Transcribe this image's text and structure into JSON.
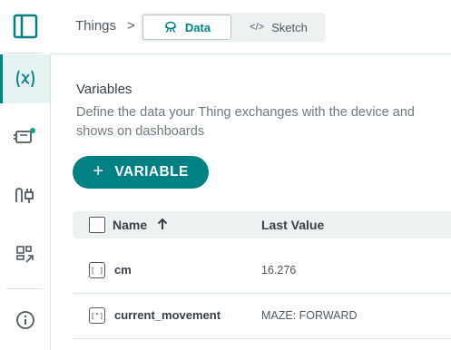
{
  "colors": {
    "accent": "#008184",
    "header_bg": "#ecf1f1",
    "text": "#374146"
  },
  "sidebar": {
    "items": [
      {
        "icon": "panel-toggle-icon",
        "active": false
      },
      {
        "icon": "variable-icon",
        "active": true
      },
      {
        "icon": "device-icon",
        "active": false,
        "badge": true
      },
      {
        "icon": "network-icon",
        "active": false
      },
      {
        "icon": "dashboard-link-icon",
        "active": false
      },
      {
        "icon": "info-icon",
        "active": false
      }
    ]
  },
  "breadcrumb": {
    "root": "Things",
    "separator": ">"
  },
  "tabs": {
    "data": "Data",
    "sketch": "Sketch",
    "sketch_glyph": "</>"
  },
  "variables": {
    "title": "Variables",
    "description": "Define the data your Thing exchanges with the device and shows on dashboards",
    "add_label": "VARIABLE",
    "add_glyph": "+"
  },
  "table": {
    "col_name": "Name",
    "col_last_value": "Last Value",
    "rows": [
      {
        "name": "cm",
        "value": "16.276",
        "type_glyph": "[ ]"
      },
      {
        "name": "current_movement",
        "value": "MAZE: FORWARD",
        "type_glyph": "[\"]"
      }
    ]
  }
}
